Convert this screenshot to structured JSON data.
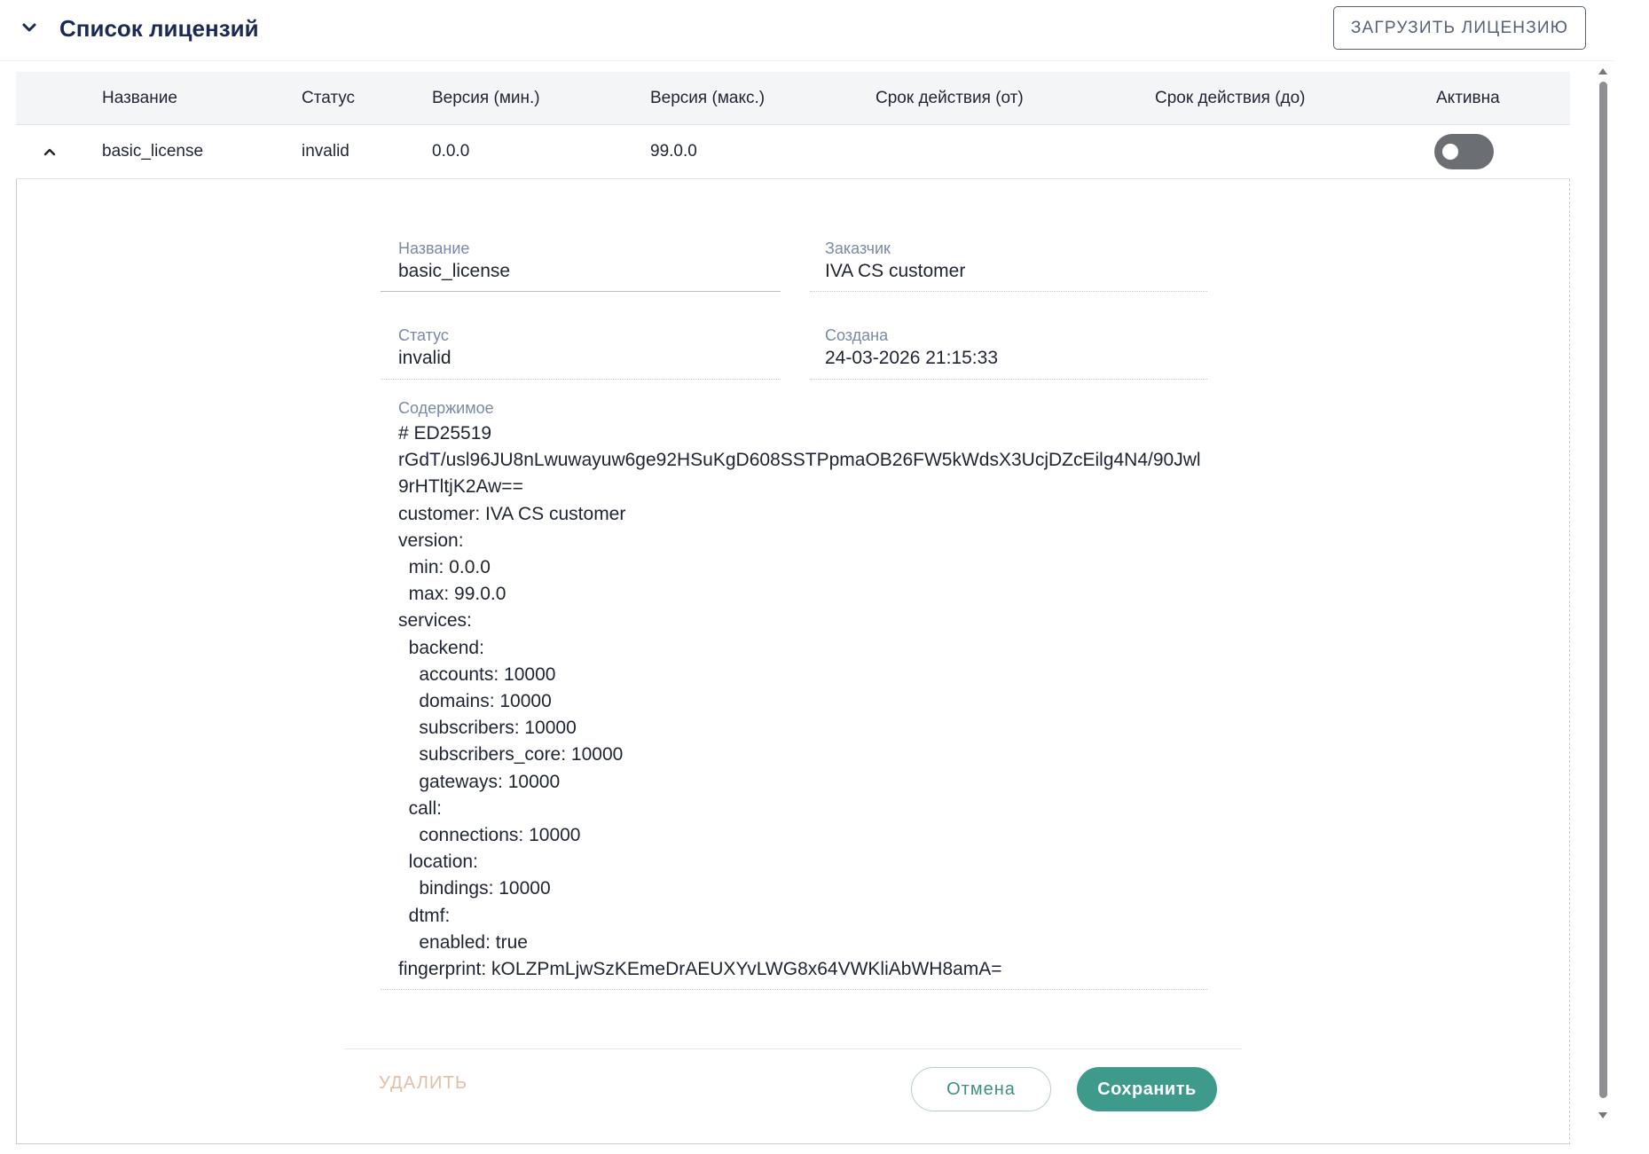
{
  "header": {
    "title": "Список лицензий",
    "upload_label": "ЗАГРУЗИТЬ ЛИЦЕНЗИЮ"
  },
  "table": {
    "columns": [
      "Название",
      "Статус",
      "Версия (мин.)",
      "Версия (макс.)",
      "Срок действия (от)",
      "Срок действия (до)",
      "Активна"
    ],
    "rows": [
      {
        "name": "basic_license",
        "status": "invalid",
        "version_min": "0.0.0",
        "version_max": "99.0.0",
        "valid_from": "",
        "valid_to": "",
        "active": false
      }
    ]
  },
  "details": {
    "name_label": "Название",
    "name_value": "basic_license",
    "customer_label": "Заказчик",
    "customer_value": "IVA CS customer",
    "status_label": "Статус",
    "status_value": "invalid",
    "created_label": "Создана",
    "created_value": "24-03-2026 21:15:33",
    "content_label": "Содержимое",
    "content_value": "# ED25519\nrGdT/usl96JU8nLwuwayuw6ge92HSuKgD608SSTPpmaOB26FW5kWdsX3UcjDZcEilg4N4/90Jwl\n9rHTltjK2Aw==\ncustomer: IVA CS customer\nversion:\n  min: 0.0.0\n  max: 99.0.0\nservices:\n  backend:\n    accounts: 10000\n    domains: 10000\n    subscribers: 10000\n    subscribers_core: 10000\n    gateways: 10000\n  call:\n    connections: 10000\n  location:\n    bindings: 10000\n  dtmf:\n    enabled: true\nfingerprint: kOLZPmLjwSzKEmeDrAEUXYvLWG8x64VWKliAbWH8amA="
  },
  "actions": {
    "delete_label": "УДАЛИТЬ",
    "cancel_label": "Отмена",
    "save_label": "Сохранить"
  },
  "icons": {
    "collapse": "chevron-down-icon",
    "row_expand": "chevron-up-icon"
  },
  "colors": {
    "title": "#1b2a55",
    "accent": "#3e9a8b",
    "label": "#7a8aa6",
    "toggle_off": "#6b6e73",
    "delete_disabled": "#e3bfa6"
  }
}
